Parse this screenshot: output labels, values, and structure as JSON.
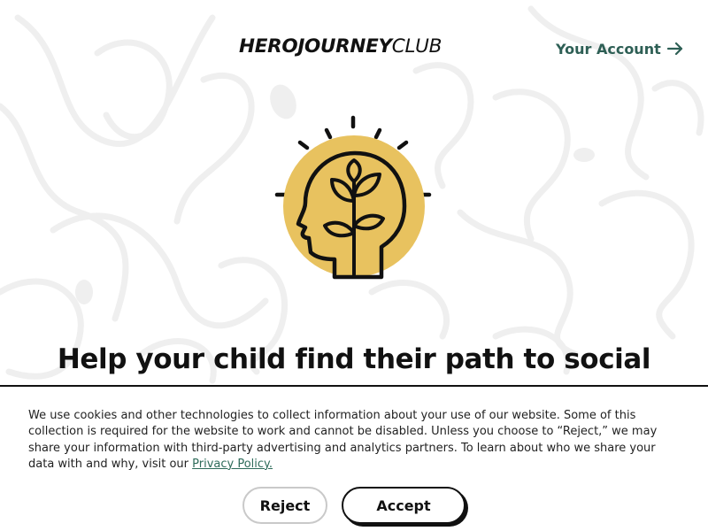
{
  "header": {
    "logo_bold": "HEROJOURNEY",
    "logo_light": "CLUB",
    "account_link": "Your Account",
    "account_icon": "arrow-right-icon"
  },
  "hero": {
    "icon": "head-with-plant-icon",
    "headline": "Help your child find their path to social"
  },
  "cookie_banner": {
    "text": "We use cookies and other technologies to collect information about your use of our website. Some of this collection is required for the website to work and cannot be disabled. Unless you choose to “Reject,” we may share your information with third-party advertising and analytics partners. To learn about who we share your data with and why, visit our ",
    "link_label": "Privacy Policy.",
    "reject_label": "Reject",
    "accept_label": "Accept"
  },
  "colors": {
    "accent": "#2e5f55",
    "sun": "#e8c25f",
    "text": "#111111",
    "pattern": "#efefef"
  }
}
